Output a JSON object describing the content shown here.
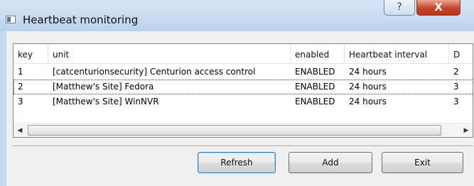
{
  "window": {
    "title": "Heartbeat monitoring",
    "help_glyph": "?",
    "close_glyph": "X"
  },
  "table": {
    "columns": [
      "key",
      "unit",
      "enabled",
      "Heartbeat interval",
      "D"
    ],
    "rows": [
      {
        "key": "1",
        "unit": "[catcenturionsecurity] Centurion access control",
        "enabled": "ENABLED",
        "interval": "24 hours",
        "d": "2"
      },
      {
        "key": "2",
        "unit": "[Matthew's Site] Fedora",
        "enabled": "ENABLED",
        "interval": "24 hours",
        "d": "3"
      },
      {
        "key": "3",
        "unit": "[Matthew's Site] WinNVR",
        "enabled": "ENABLED",
        "interval": "24 hours",
        "d": "3"
      }
    ],
    "scroll_left_glyph": "◀",
    "scroll_right_glyph": "▶"
  },
  "buttons": {
    "refresh": "Refresh",
    "add": "Add",
    "exit": "Exit"
  }
}
